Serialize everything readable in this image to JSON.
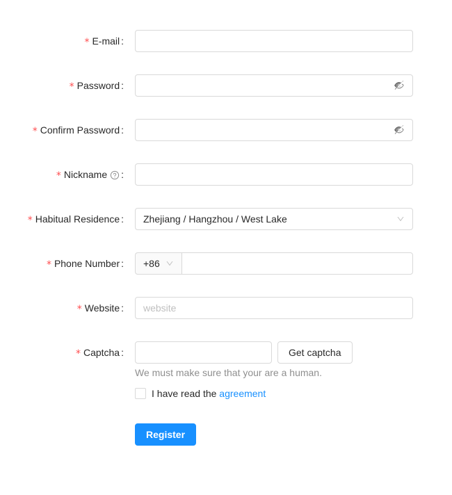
{
  "form": {
    "fields": {
      "email": {
        "label": "E-mail",
        "required_marker": "*",
        "colon": ":",
        "value": "",
        "placeholder": ""
      },
      "password": {
        "label": "Password",
        "required_marker": "*",
        "colon": ":",
        "value": "",
        "placeholder": "",
        "suffix_icon": "eye-invisible-icon"
      },
      "confirm_password": {
        "label": "Confirm Password",
        "required_marker": "*",
        "colon": ":",
        "value": "",
        "placeholder": "",
        "suffix_icon": "eye-invisible-icon"
      },
      "nickname": {
        "label": "Nickname",
        "required_marker": "*",
        "colon": ":",
        "value": "",
        "placeholder": "",
        "help_icon": "question-circle-icon"
      },
      "habitual_residence": {
        "label": "Habitual Residence",
        "required_marker": "*",
        "colon": ":",
        "value": "Zhejiang / Hangzhou / West Lake",
        "arrow_icon": "chevron-down-icon"
      },
      "phone_number": {
        "label": "Phone Number",
        "required_marker": "*",
        "colon": ":",
        "prefix_value": "+86",
        "prefix_arrow_icon": "chevron-down-icon",
        "value": "",
        "placeholder": ""
      },
      "website": {
        "label": "Website",
        "required_marker": "*",
        "colon": ":",
        "value": "",
        "placeholder": "website"
      },
      "captcha": {
        "label": "Captcha",
        "required_marker": "*",
        "colon": ":",
        "value": "",
        "placeholder": "",
        "get_captcha_label": "Get captcha",
        "extra": "We must make sure that your are a human."
      }
    },
    "agreement": {
      "checked": false,
      "text_before": "I have read the",
      "link_label": "agreement"
    },
    "submit": {
      "label": "Register"
    }
  },
  "colors": {
    "primary": "#1890ff",
    "required_asterisk": "#ff4d4f",
    "border": "#d9d9d9",
    "link": "#1890ff",
    "placeholder": "#bfbfbf",
    "addon_background": "#fafafa",
    "extra_text": "rgba(0, 0, 0, 0.45)"
  }
}
